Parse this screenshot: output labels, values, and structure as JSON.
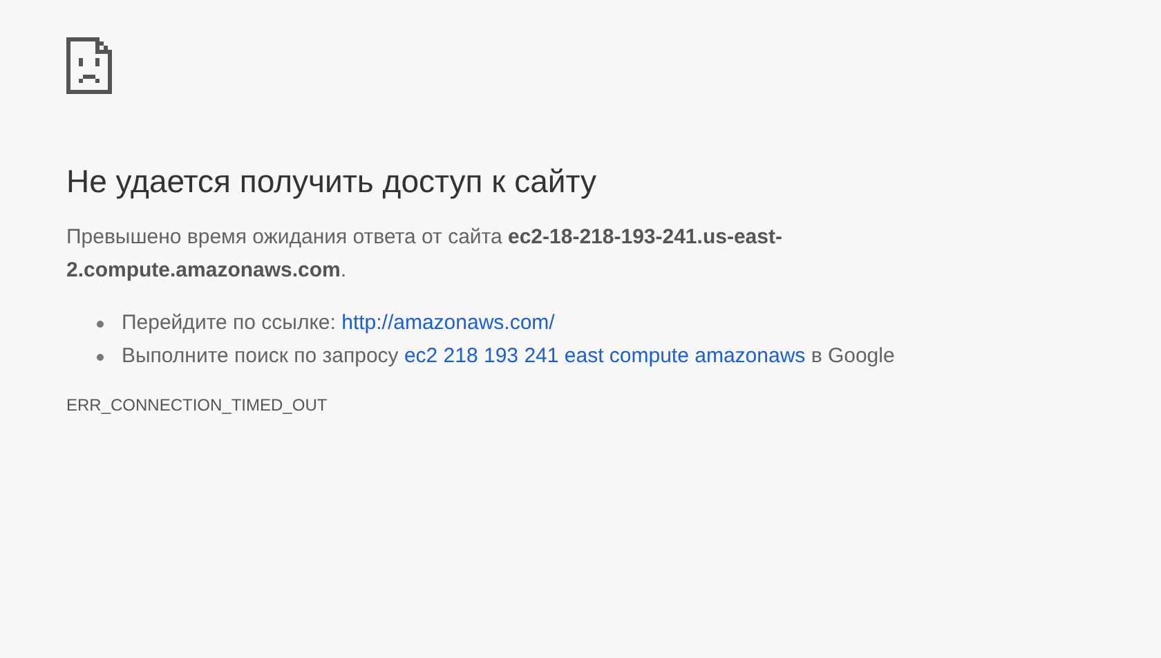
{
  "title": "Не удается получить доступ к сайту",
  "message": "Превышено время ожидания ответа от сайта **ec2-18-218-193-241.us-east-2.compute.amazonaws.com**.",
  "suggestions": [
    {
      "text": "Перейдите по ссылке: ",
      "link": "http://amazonaws.com/"
    },
    {
      "text": "Выполните поиск по запросу ",
      "link": "ec2 218 193 241 east compute amazonaws",
      "suffix": " в Google"
    }
  ],
  "error_code": "ERR_CONNECTION_TIMED_OUT"
}
